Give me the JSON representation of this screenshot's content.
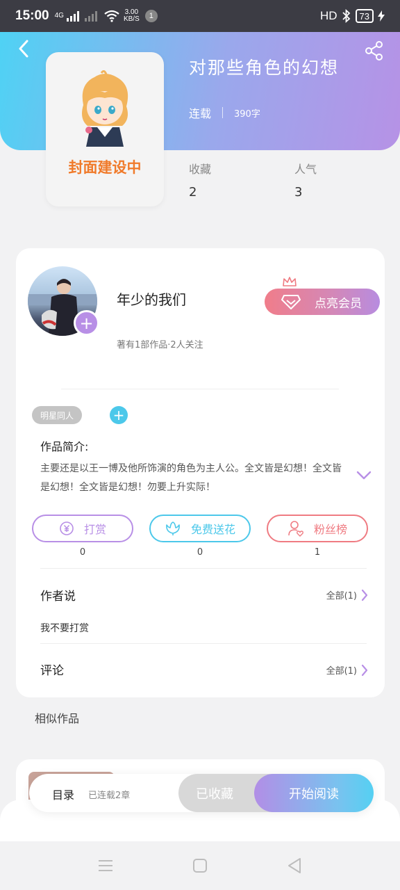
{
  "status_bar": {
    "time": "15:00",
    "network": "4G",
    "speed_value": "3.00",
    "speed_unit": "KB/S",
    "notification_count": "1",
    "hd": "HD",
    "battery": "73"
  },
  "book": {
    "title": "对那些角色的幻想",
    "status": "连载",
    "word_count": "390字",
    "cover_label": "封面建设中",
    "favorites_label": "收藏",
    "favorites_value": "2",
    "popularity_label": "人气",
    "popularity_value": "3"
  },
  "author": {
    "name": "年少的我们",
    "info": "著有1部作品·2人关注",
    "vip_label": "点亮会员"
  },
  "tag": {
    "label": "明星同人"
  },
  "intro": {
    "title": "作品简介:",
    "text": "主要还是以王一博及他所饰演的角色为主人公。全文皆是幻想！全文皆是幻想！全文皆是幻想！勿要上升实际！"
  },
  "actions": [
    {
      "label": "打赏",
      "count": "0",
      "color": "#b88fe6"
    },
    {
      "label": "免费送花",
      "count": "0",
      "color": "#4cc8ea"
    },
    {
      "label": "粉丝榜",
      "count": "1",
      "color": "#ef7b82"
    }
  ],
  "author_says": {
    "title": "作者说",
    "more": "全部(1)",
    "text": "我不要打赏"
  },
  "comments": {
    "title": "评论",
    "more": "全部(1)"
  },
  "similar": {
    "title": "相似作品"
  },
  "bottom_bar": {
    "toc": "目录",
    "progress": "已连载2章",
    "collected": "已收藏",
    "read": "开始阅读"
  },
  "colors": {
    "purple": "#b88fe6",
    "cyan": "#4cc8ea",
    "coral": "#ef7b82",
    "orange": "#f07a2a"
  }
}
